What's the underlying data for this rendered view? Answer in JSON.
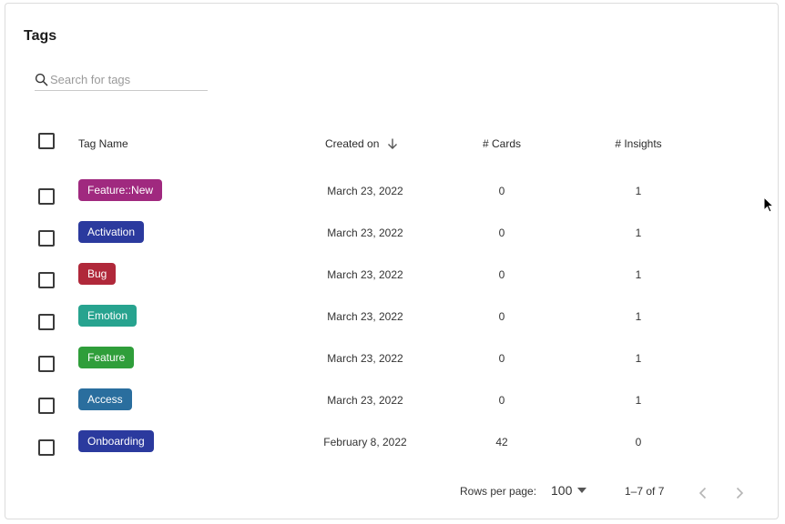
{
  "page": {
    "title": "Tags"
  },
  "search": {
    "placeholder": "Search for tags"
  },
  "table": {
    "columns": {
      "name": "Tag Name",
      "created": "Created on",
      "cards": "# Cards",
      "insights": "# Insights"
    },
    "sort": {
      "column": "created",
      "direction": "descending"
    },
    "rows": [
      {
        "tag": "Feature::New",
        "color": "#a0297f",
        "created": "March 23, 2022",
        "cards": "0",
        "insights": "1"
      },
      {
        "tag": "Activation",
        "color": "#2b3a9e",
        "created": "March 23, 2022",
        "cards": "0",
        "insights": "1"
      },
      {
        "tag": "Bug",
        "color": "#b0283a",
        "created": "March 23, 2022",
        "cards": "0",
        "insights": "1"
      },
      {
        "tag": "Emotion",
        "color": "#27a38f",
        "created": "March 23, 2022",
        "cards": "0",
        "insights": "1"
      },
      {
        "tag": "Feature",
        "color": "#2f9e3a",
        "created": "March 23, 2022",
        "cards": "0",
        "insights": "1"
      },
      {
        "tag": "Access",
        "color": "#2a6e9e",
        "created": "March 23, 2022",
        "cards": "0",
        "insights": "1"
      },
      {
        "tag": "Onboarding",
        "color": "#2b3a9e",
        "created": "February 8, 2022",
        "cards": "42",
        "insights": "0"
      }
    ]
  },
  "pagination": {
    "rows_per_page_label": "Rows per page:",
    "rows_per_page": "100",
    "range": "1–7 of 7"
  },
  "icons": {
    "search": "search-icon",
    "sort": "arrow-down-icon",
    "dropdown": "caret-down-icon",
    "prev": "chevron-left-icon",
    "next": "chevron-right-icon"
  }
}
